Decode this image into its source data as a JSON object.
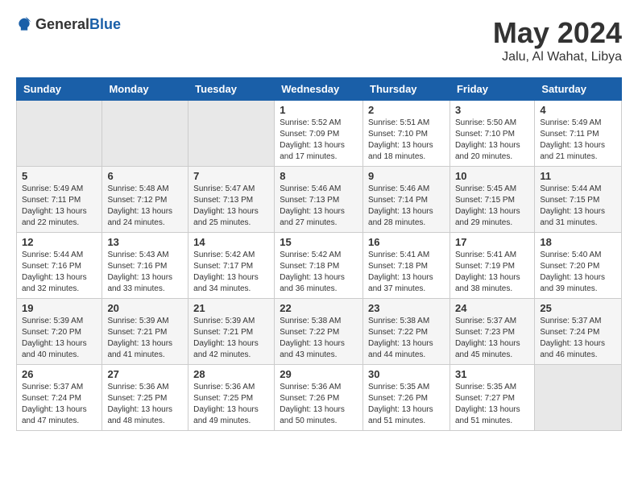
{
  "logo": {
    "text_general": "General",
    "text_blue": "Blue"
  },
  "title": {
    "month_year": "May 2024",
    "location": "Jalu, Al Wahat, Libya"
  },
  "weekdays": [
    "Sunday",
    "Monday",
    "Tuesday",
    "Wednesday",
    "Thursday",
    "Friday",
    "Saturday"
  ],
  "weeks": [
    [
      {
        "day": "",
        "info": ""
      },
      {
        "day": "",
        "info": ""
      },
      {
        "day": "",
        "info": ""
      },
      {
        "day": "1",
        "info": "Sunrise: 5:52 AM\nSunset: 7:09 PM\nDaylight: 13 hours\nand 17 minutes."
      },
      {
        "day": "2",
        "info": "Sunrise: 5:51 AM\nSunset: 7:10 PM\nDaylight: 13 hours\nand 18 minutes."
      },
      {
        "day": "3",
        "info": "Sunrise: 5:50 AM\nSunset: 7:10 PM\nDaylight: 13 hours\nand 20 minutes."
      },
      {
        "day": "4",
        "info": "Sunrise: 5:49 AM\nSunset: 7:11 PM\nDaylight: 13 hours\nand 21 minutes."
      }
    ],
    [
      {
        "day": "5",
        "info": "Sunrise: 5:49 AM\nSunset: 7:11 PM\nDaylight: 13 hours\nand 22 minutes."
      },
      {
        "day": "6",
        "info": "Sunrise: 5:48 AM\nSunset: 7:12 PM\nDaylight: 13 hours\nand 24 minutes."
      },
      {
        "day": "7",
        "info": "Sunrise: 5:47 AM\nSunset: 7:13 PM\nDaylight: 13 hours\nand 25 minutes."
      },
      {
        "day": "8",
        "info": "Sunrise: 5:46 AM\nSunset: 7:13 PM\nDaylight: 13 hours\nand 27 minutes."
      },
      {
        "day": "9",
        "info": "Sunrise: 5:46 AM\nSunset: 7:14 PM\nDaylight: 13 hours\nand 28 minutes."
      },
      {
        "day": "10",
        "info": "Sunrise: 5:45 AM\nSunset: 7:15 PM\nDaylight: 13 hours\nand 29 minutes."
      },
      {
        "day": "11",
        "info": "Sunrise: 5:44 AM\nSunset: 7:15 PM\nDaylight: 13 hours\nand 31 minutes."
      }
    ],
    [
      {
        "day": "12",
        "info": "Sunrise: 5:44 AM\nSunset: 7:16 PM\nDaylight: 13 hours\nand 32 minutes."
      },
      {
        "day": "13",
        "info": "Sunrise: 5:43 AM\nSunset: 7:16 PM\nDaylight: 13 hours\nand 33 minutes."
      },
      {
        "day": "14",
        "info": "Sunrise: 5:42 AM\nSunset: 7:17 PM\nDaylight: 13 hours\nand 34 minutes."
      },
      {
        "day": "15",
        "info": "Sunrise: 5:42 AM\nSunset: 7:18 PM\nDaylight: 13 hours\nand 36 minutes."
      },
      {
        "day": "16",
        "info": "Sunrise: 5:41 AM\nSunset: 7:18 PM\nDaylight: 13 hours\nand 37 minutes."
      },
      {
        "day": "17",
        "info": "Sunrise: 5:41 AM\nSunset: 7:19 PM\nDaylight: 13 hours\nand 38 minutes."
      },
      {
        "day": "18",
        "info": "Sunrise: 5:40 AM\nSunset: 7:20 PM\nDaylight: 13 hours\nand 39 minutes."
      }
    ],
    [
      {
        "day": "19",
        "info": "Sunrise: 5:39 AM\nSunset: 7:20 PM\nDaylight: 13 hours\nand 40 minutes."
      },
      {
        "day": "20",
        "info": "Sunrise: 5:39 AM\nSunset: 7:21 PM\nDaylight: 13 hours\nand 41 minutes."
      },
      {
        "day": "21",
        "info": "Sunrise: 5:39 AM\nSunset: 7:21 PM\nDaylight: 13 hours\nand 42 minutes."
      },
      {
        "day": "22",
        "info": "Sunrise: 5:38 AM\nSunset: 7:22 PM\nDaylight: 13 hours\nand 43 minutes."
      },
      {
        "day": "23",
        "info": "Sunrise: 5:38 AM\nSunset: 7:22 PM\nDaylight: 13 hours\nand 44 minutes."
      },
      {
        "day": "24",
        "info": "Sunrise: 5:37 AM\nSunset: 7:23 PM\nDaylight: 13 hours\nand 45 minutes."
      },
      {
        "day": "25",
        "info": "Sunrise: 5:37 AM\nSunset: 7:24 PM\nDaylight: 13 hours\nand 46 minutes."
      }
    ],
    [
      {
        "day": "26",
        "info": "Sunrise: 5:37 AM\nSunset: 7:24 PM\nDaylight: 13 hours\nand 47 minutes."
      },
      {
        "day": "27",
        "info": "Sunrise: 5:36 AM\nSunset: 7:25 PM\nDaylight: 13 hours\nand 48 minutes."
      },
      {
        "day": "28",
        "info": "Sunrise: 5:36 AM\nSunset: 7:25 PM\nDaylight: 13 hours\nand 49 minutes."
      },
      {
        "day": "29",
        "info": "Sunrise: 5:36 AM\nSunset: 7:26 PM\nDaylight: 13 hours\nand 50 minutes."
      },
      {
        "day": "30",
        "info": "Sunrise: 5:35 AM\nSunset: 7:26 PM\nDaylight: 13 hours\nand 51 minutes."
      },
      {
        "day": "31",
        "info": "Sunrise: 5:35 AM\nSunset: 7:27 PM\nDaylight: 13 hours\nand 51 minutes."
      },
      {
        "day": "",
        "info": ""
      }
    ]
  ]
}
